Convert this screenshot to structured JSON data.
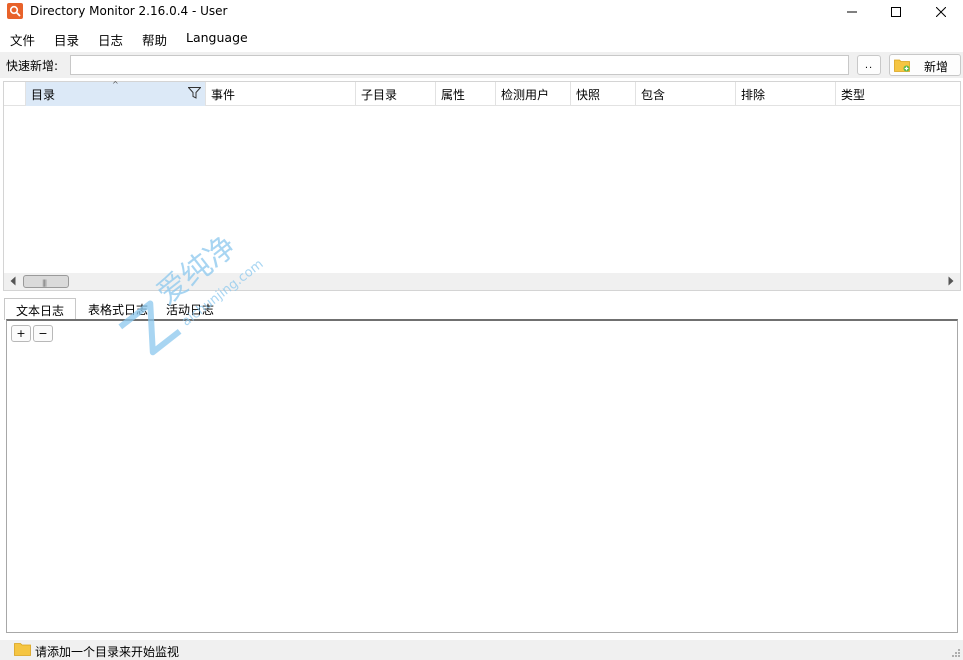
{
  "window": {
    "title": "Directory Monitor 2.16.0.4 - User",
    "accent": "#e8622a"
  },
  "menu": {
    "items": [
      "文件",
      "目录",
      "日志",
      "帮助",
      "Language"
    ]
  },
  "quick_add": {
    "label": "快速新增:",
    "value": "",
    "browse_label": "..",
    "add_label": "新增"
  },
  "grid": {
    "columns": [
      "目录",
      "事件",
      "子目录",
      "属性",
      "检测用户",
      "快照",
      "包含",
      "排除",
      "类型"
    ],
    "sorted_column": "目录",
    "rows": []
  },
  "tabs": [
    "文本日志",
    "表格式日志",
    "活动日志"
  ],
  "active_tab": "文本日志",
  "log_panel": {
    "expand_label": "+",
    "collapse_label": "−"
  },
  "watermark": {
    "text": "爱纯净",
    "url": "aichunjing.com"
  },
  "status": {
    "text": "请添加一个目录来开始监视"
  }
}
